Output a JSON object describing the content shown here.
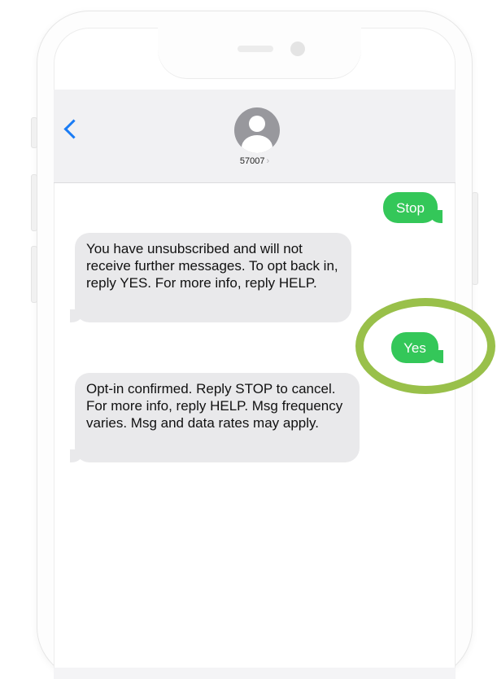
{
  "header": {
    "contact_name": "57007",
    "chevron": "›",
    "back_icon": "chevron-left-icon",
    "avatar_icon": "person-icon"
  },
  "messages": [
    {
      "direction": "outgoing",
      "text": "Stop"
    },
    {
      "direction": "incoming",
      "text": "You have unsubscribed and will not receive further messages. To opt back in, reply YES. For more info, reply HELP."
    },
    {
      "direction": "outgoing",
      "text": "Yes"
    },
    {
      "direction": "incoming",
      "text": "Opt-in confirmed. Reply STOP to cancel. For more info, reply HELP. Msg frequency varies. Msg and data rates may apply."
    }
  ],
  "colors": {
    "outgoing_bubble": "#34c759",
    "incoming_bubble": "#e9e9eb",
    "highlight_ring": "#99c04a",
    "accent": "#1a7cf5"
  }
}
